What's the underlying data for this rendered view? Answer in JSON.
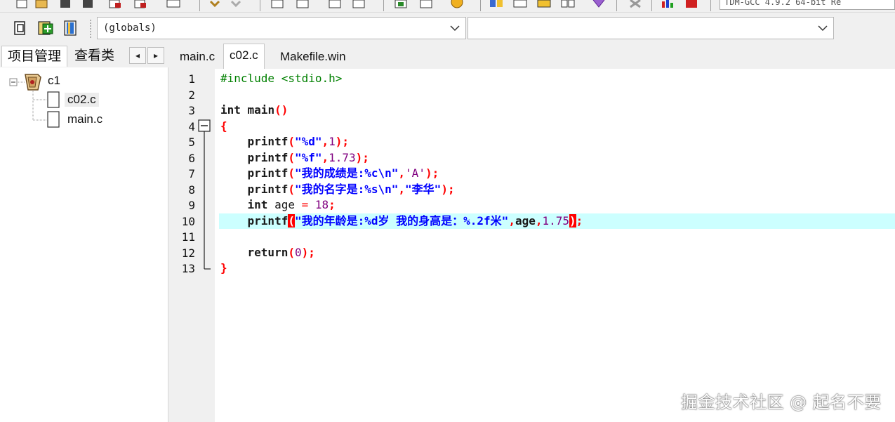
{
  "toolbar": {
    "compiler_label": "TDM-GCC 4.9.2 64-bit Re",
    "icons": [
      "new-file-icon",
      "open-icon",
      "save-icon",
      "save-all-icon",
      "close-icon",
      "close-all-icon",
      "print-icon",
      "undo-icon",
      "redo-icon",
      "find-icon",
      "replace-icon",
      "goto-icon",
      "compile-icon",
      "run-icon",
      "compile-run-icon",
      "debug-icon",
      "windows-icon",
      "grid-icon",
      "chart-icon",
      "check-icon",
      "stop-icon",
      "profile-icon",
      "delete-profile-icon"
    ]
  },
  "toolbar2": {
    "icons": [
      "new-project-icon",
      "add-file-icon",
      "remove-file-icon"
    ],
    "scope_combo": "(globals)",
    "function_combo": ""
  },
  "left_panel": {
    "tabs": [
      {
        "label": "项目管理"
      },
      {
        "label": "查看类"
      }
    ],
    "nav_prev": "◂",
    "nav_next": "▸",
    "tree": {
      "project": "c1",
      "files": [
        "c02.c",
        "main.c"
      ]
    }
  },
  "editor": {
    "tabs": [
      {
        "label": "main.c"
      },
      {
        "label": "c02.c"
      },
      {
        "label": "Makefile.win"
      }
    ],
    "active_tab": "c02.c",
    "line_numbers": [
      "1",
      "2",
      "3",
      "4",
      "5",
      "6",
      "7",
      "8",
      "9",
      "10",
      "11",
      "12",
      "13"
    ],
    "highlighted_line": 10,
    "code": {
      "l1_pp": "#include <stdio.h>",
      "l3_kw": "int",
      "l3_id": " main",
      "l3_sym": "()",
      "l4": "{",
      "l5_fn": "    printf",
      "l5_a": "(",
      "l5_str": "\"%d\"",
      "l5_b": ",",
      "l5_num": "1",
      "l5_c": ");",
      "l6_fn": "    printf",
      "l6_a": "(",
      "l6_str": "\"%f\"",
      "l6_b": ",",
      "l6_num": "1.73",
      "l6_c": ");",
      "l7_fn": "    printf",
      "l7_a": "(",
      "l7_str": "\"我的成绩是:%c\\n\"",
      "l7_b": ",",
      "l7_chr": "'A'",
      "l7_c": ");",
      "l8_fn": "    printf",
      "l8_a": "(",
      "l8_str": "\"我的名字是:%s\\n\"",
      "l8_b": ",",
      "l8_str2": "\"李华\"",
      "l8_c": ");",
      "l9_kw": "    int",
      "l9_id": " age ",
      "l9_eq": "=",
      "l9_sp": " ",
      "l9_num": "18",
      "l9_c": ";",
      "l10_fn": "    printf",
      "l10_a": "(",
      "l10_str": "\"我的年龄是:%d岁 我的身高是：%.2f米\"",
      "l10_b": ",",
      "l10_id": "age",
      "l10_b2": ",",
      "l10_num": "1.75",
      "l10_c": ")",
      "l10_d": ";",
      "l12_kw": "    return",
      "l12_a": "(",
      "l12_num": "0",
      "l12_c": ");",
      "l13": "}"
    }
  },
  "watermark": "掘金技术社区 @ 起名不要"
}
